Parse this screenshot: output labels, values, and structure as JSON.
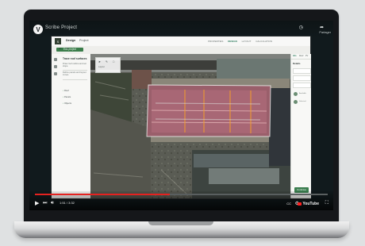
{
  "player": {
    "channel_logo": "V",
    "video_title": "Scribe Project",
    "watch_later_icon": "clock-icon",
    "share_icon": "share-icon",
    "share_label": "Partager",
    "time": "1:51 / 3:32",
    "progress": 0.46,
    "platform_label": "YouTube",
    "brand_color": "#ff1f1f"
  },
  "app": {
    "logo_text": "S",
    "tabs": [
      {
        "label": "Design"
      },
      {
        "label": "Project"
      }
    ],
    "selected_tool": "Edit project",
    "top_tabs": [
      {
        "label": "PROPERTIES"
      },
      {
        "label": "DESIGN"
      },
      {
        "label": "LAYOUT"
      },
      {
        "label": "CALCULATION"
      }
    ],
    "left_panel": {
      "title": "Trace roof surfaces",
      "text_1": "Draw roof outline and set slope.",
      "text_2": "Define panels and layout zones.",
      "items": [
        {
          "label": "Roof"
        },
        {
          "label": "Panels"
        },
        {
          "label": "Objects"
        }
      ]
    },
    "map_toolbar": {
      "icon_1": "cursor-icon",
      "icon_2": "pencil-icon",
      "icon_3": "square-icon",
      "text": "Layout"
    },
    "right_panel": {
      "tabs": [
        {
          "label": "Info"
        },
        {
          "label": "Roof"
        },
        {
          "label": "PV"
        }
      ],
      "title": "Details",
      "small_text_1": "Available",
      "small_text_2": "Selected",
      "button_label": "Continue"
    }
  }
}
